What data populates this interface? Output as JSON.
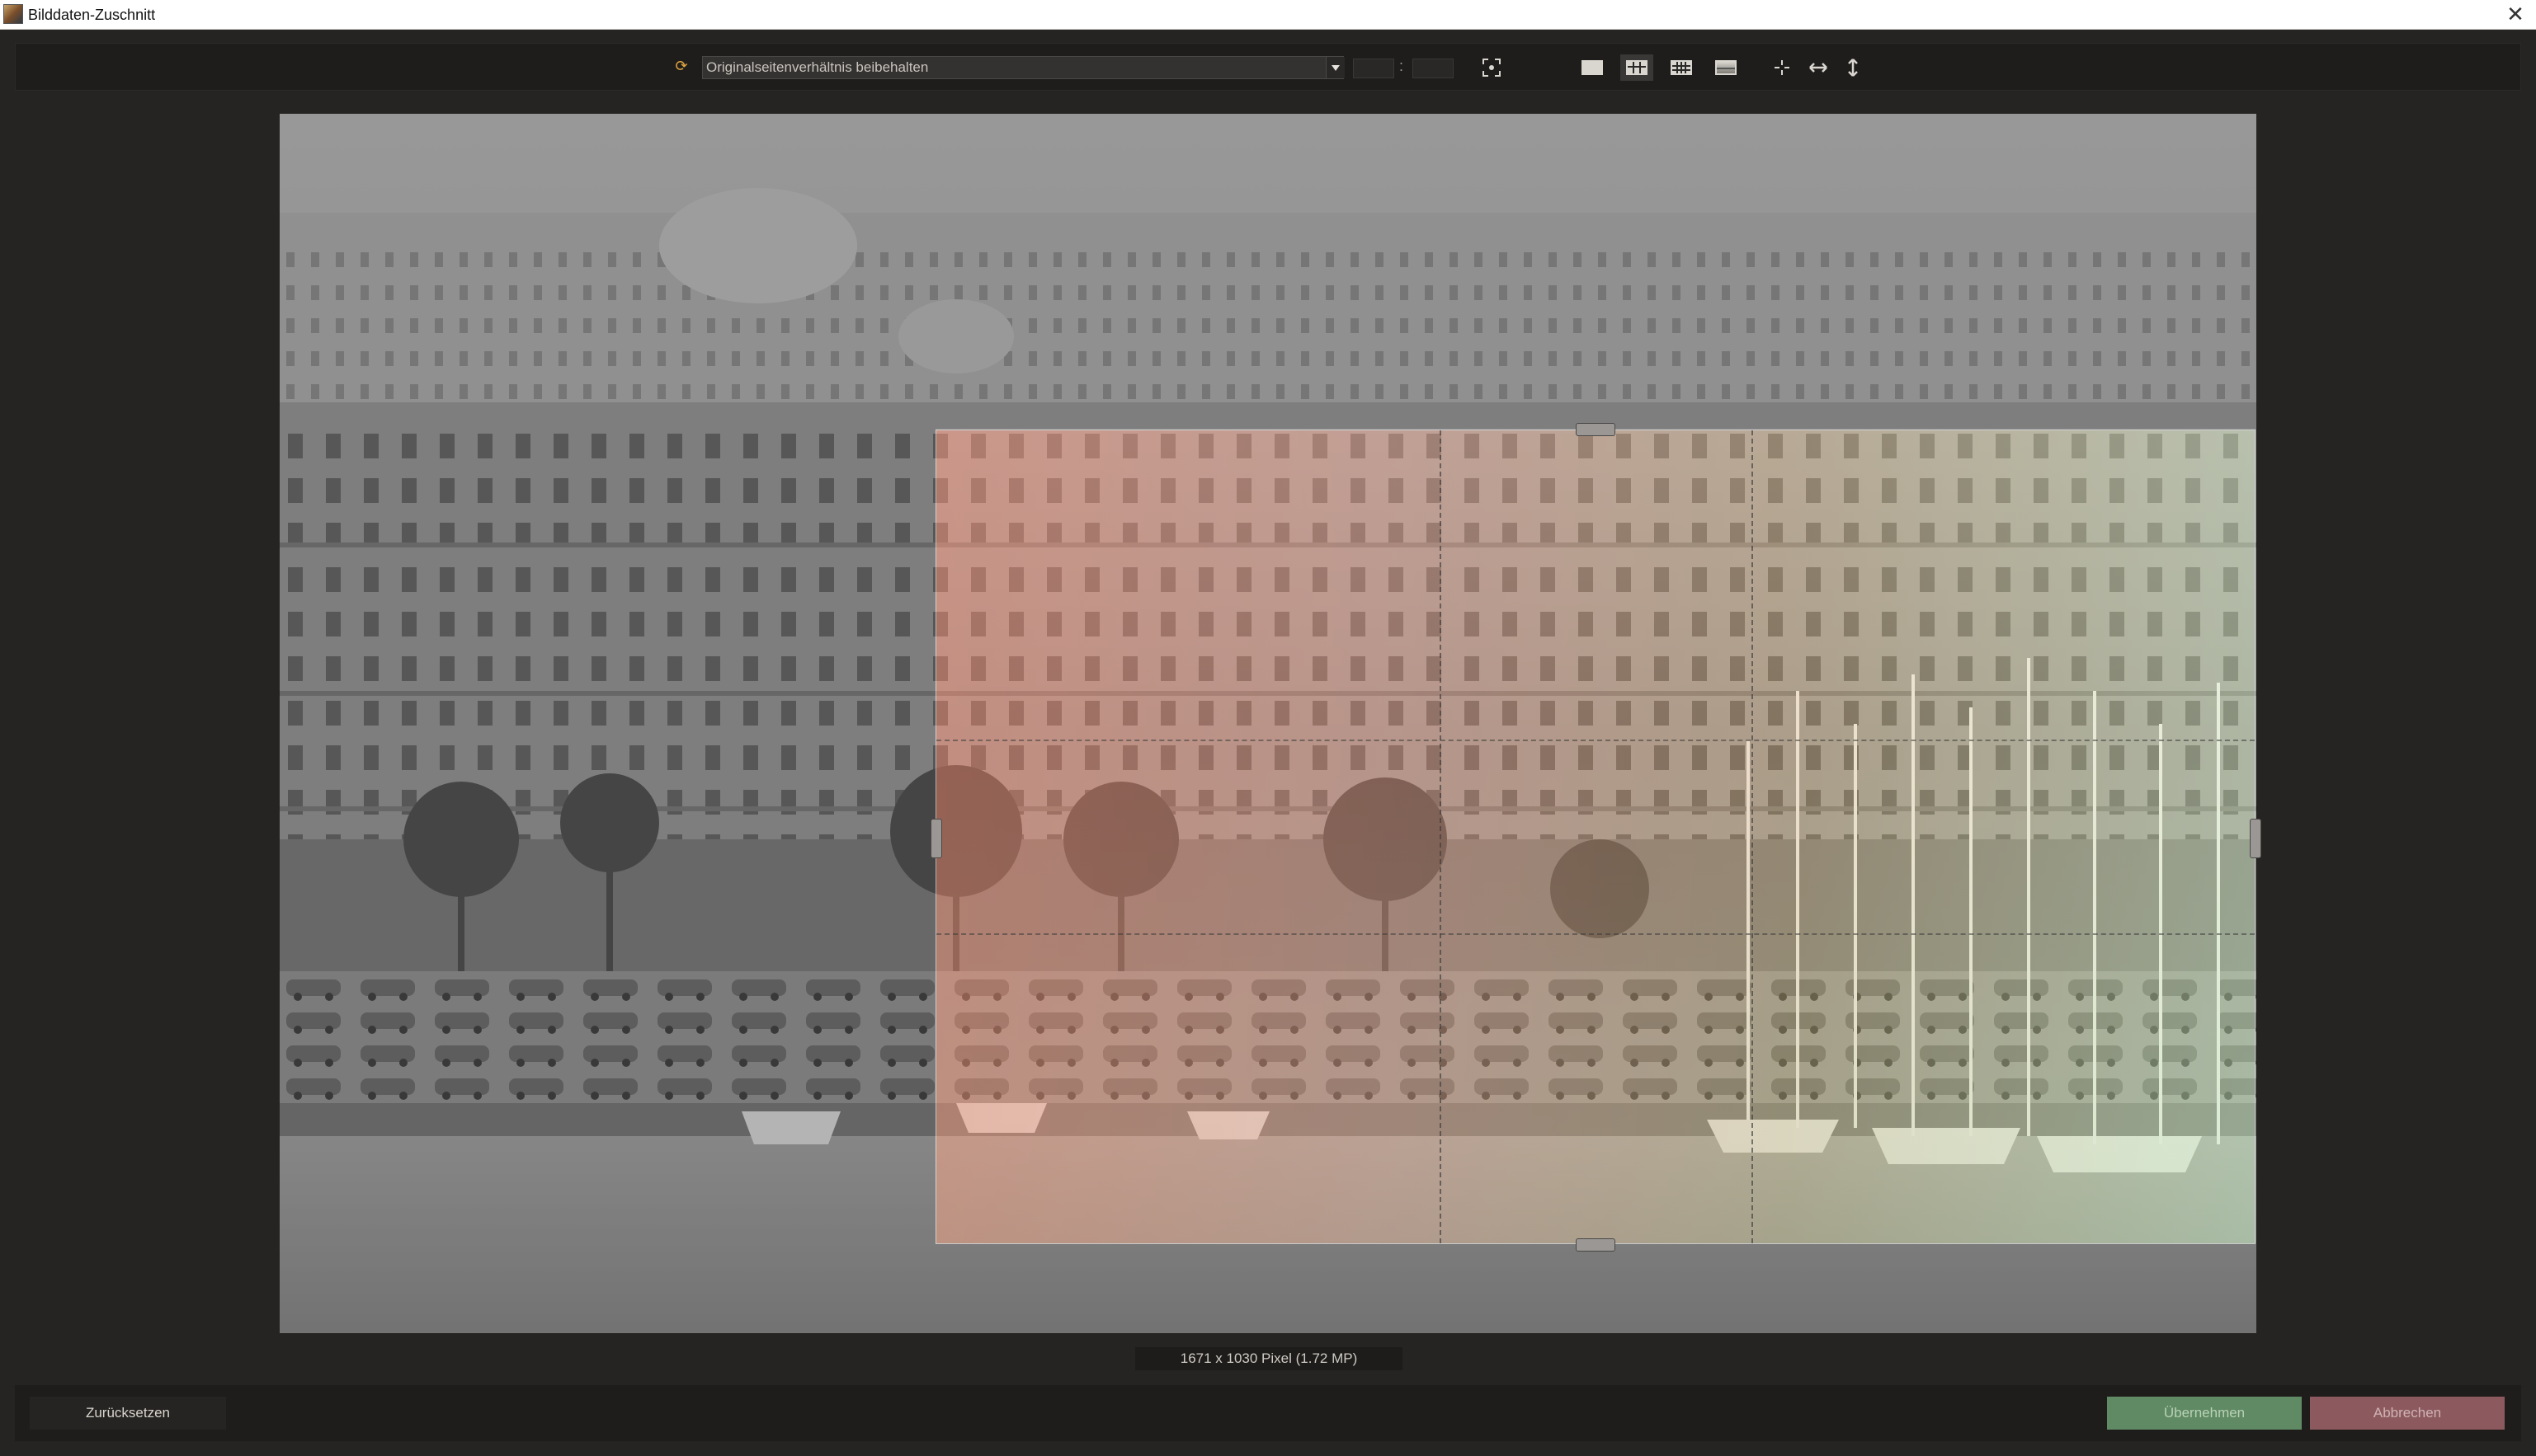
{
  "window": {
    "title": "Bilddaten-Zuschnitt",
    "close_glyph": "✕",
    "app_icon": "photo-app-icon"
  },
  "toolbar": {
    "ratio_icon": "aspect-ratio-icon",
    "ratio_select": {
      "value": "Originalseitenverhältnis beibehalten"
    },
    "width_value": "",
    "height_value": "",
    "separator": ":",
    "icons": [
      "fit-crop-icon",
      "no-grid-icon",
      "grid-thirds-icon",
      "grid-fine-icon",
      "grid-photo-icon",
      "center-crosshair-icon",
      "horizontal-flip-icon",
      "vertical-flip-icon"
    ]
  },
  "status": {
    "dimensions": "1671 x 1030  Pixel  (1.72 MP)"
  },
  "buttons": {
    "reset": "Zurücksetzen",
    "apply": "Übernehmen",
    "cancel": "Abbrechen"
  },
  "colors": {
    "accent_icon": "#e2a640",
    "apply_bg": "#5f8a63",
    "cancel_bg": "#8c5a5e",
    "background": "#262422"
  }
}
